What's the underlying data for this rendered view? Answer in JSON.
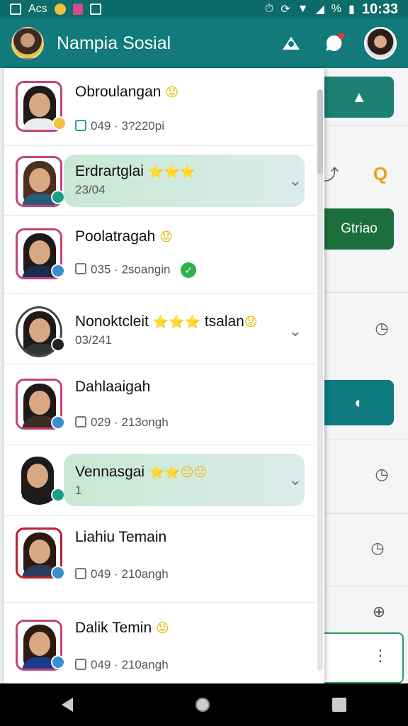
{
  "status_bar": {
    "left_text": "Acs",
    "battery_text": "%",
    "time": "10:33"
  },
  "app_bar": {
    "title": "Nampia Sosial"
  },
  "background_panel": {
    "button_label": "Gtriao"
  },
  "contacts": [
    {
      "name": "Obroulangan",
      "name_emoji": "😟",
      "meta": "049 · 3?220pi",
      "expanded": false
    },
    {
      "name": "Erdrartglai",
      "name_emoji": "⭐⭐⭐",
      "meta": "23/04",
      "expanded": true
    },
    {
      "name": "Poolatragah",
      "name_emoji": "😟",
      "meta": "035 · 2soangin",
      "verified": true,
      "expanded": false
    },
    {
      "name": "Nonoktcleit",
      "name_emoji": "⭐⭐⭐",
      "name_suffix": "tsalan",
      "suffix_emoji": "😟",
      "meta": "03/241",
      "expanded": false,
      "chevron": true
    },
    {
      "name": "Dahlaaigah",
      "name_emoji": "",
      "meta": "029 · 213ongh",
      "expanded": false
    },
    {
      "name": "Vennasgai",
      "name_emoji": "⭐⭐😐😐",
      "meta": "1",
      "expanded": true
    },
    {
      "name": "Liahiu Temain",
      "name_emoji": "",
      "meta": "049 · 210angh",
      "expanded": false
    },
    {
      "name": "Dalik Temin",
      "name_emoji": "😟",
      "meta": "049 · 210angh",
      "expanded": false
    }
  ],
  "colors": {
    "app_bar": "#127a7a",
    "status_bar": "#0c6b6b",
    "accent_green": "#1b6f3d",
    "avatar_border": "#c3447c"
  }
}
